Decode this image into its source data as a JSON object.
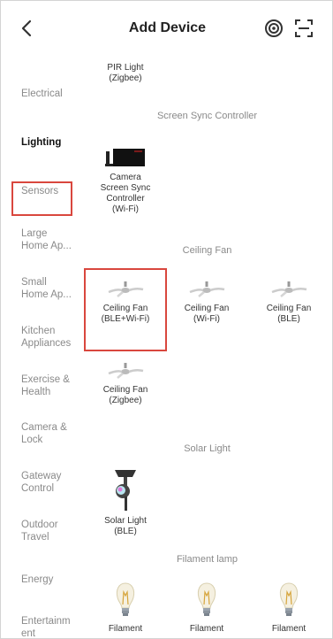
{
  "header": {
    "back_icon": "chevron-left-icon",
    "title": "Add Device",
    "radar_icon": "radar-icon",
    "scan_icon": "scan-icon"
  },
  "sidebar": {
    "items": [
      {
        "label": "Electrical"
      },
      {
        "label": "Lighting",
        "selected": true
      },
      {
        "label": "Sensors"
      },
      {
        "label": "Large\nHome Ap..."
      },
      {
        "label": "Small\nHome Ap..."
      },
      {
        "label": "Kitchen\nAppliances"
      },
      {
        "label": "Exercise &\nHealth"
      },
      {
        "label": "Camera &\nLock"
      },
      {
        "label": "Gateway\nControl"
      },
      {
        "label": "Outdoor\nTravel"
      },
      {
        "label": "Energy"
      },
      {
        "label": "Entertainm\nent"
      }
    ]
  },
  "content": {
    "top_partial_device": {
      "label": "PIR Light\n(Zigbee)"
    },
    "sections": [
      {
        "title": "Screen Sync Controller",
        "devices": [
          {
            "label": "Camera\nScreen Sync\nController\n(Wi-Fi)",
            "icon": "screen-sync-icon"
          }
        ]
      },
      {
        "title": "Ceiling Fan",
        "devices": [
          {
            "label": "Ceiling Fan\n(BLE+Wi-Fi)",
            "icon": "ceiling-fan-icon",
            "highlighted": true
          },
          {
            "label": "Ceiling Fan\n(Wi-Fi)",
            "icon": "ceiling-fan-icon"
          },
          {
            "label": "Ceiling Fan\n(BLE)",
            "icon": "ceiling-fan-icon"
          },
          {
            "label": "Ceiling Fan\n(Zigbee)",
            "icon": "ceiling-fan-icon"
          }
        ]
      },
      {
        "title": "Solar Light",
        "devices": [
          {
            "label": "Solar Light\n(BLE)",
            "icon": "solar-light-icon"
          }
        ]
      },
      {
        "title": "Filament lamp",
        "devices": [
          {
            "label": "Filament",
            "icon": "filament-bulb-icon"
          },
          {
            "label": "Filament",
            "icon": "filament-bulb-icon"
          },
          {
            "label": "Filament",
            "icon": "filament-bulb-icon"
          }
        ]
      }
    ]
  },
  "colors": {
    "highlight": "#d9473e",
    "muted_text": "#8a8a8a",
    "primary_text": "#222222"
  }
}
